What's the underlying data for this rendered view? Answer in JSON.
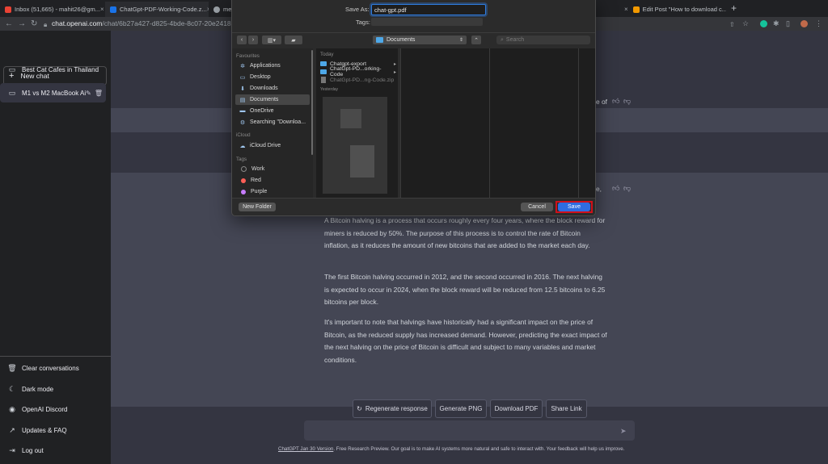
{
  "browser": {
    "tabs": [
      {
        "title": "Inbox (51,665) - mahit26@gm...",
        "color": "#ea4335"
      },
      {
        "title": "ChatGpt-PDF-Working-Code.z...",
        "color": "#1a73e8"
      },
      {
        "title": "me...",
        "color": "#9aa0a6"
      },
      {
        "title": "Edit Post \"How to download c...",
        "color": "#f29900"
      }
    ],
    "url_host": "chat.openai.com",
    "url_path": "/chat/6b27a427-d825-4bde-8c07-20e2418..."
  },
  "sidebar": {
    "new_chat": "New chat",
    "chats": [
      "Best Cat Cafes in Thailand",
      "M1 vs M2 MacBook Ai"
    ],
    "bottom": [
      "Clear conversations",
      "Dark mode",
      "OpenAI Discord",
      "Updates & FAQ",
      "Log out"
    ]
  },
  "dialog": {
    "save_as_label": "Save As:",
    "filename": "chat-gpt.pdf",
    "tags_label": "Tags:",
    "location": "Documents",
    "search_placeholder": "Search",
    "favourites_header": "Favourites",
    "favourites": [
      "Applications",
      "Desktop",
      "Downloads",
      "Documents",
      "OneDrive",
      "Searching \"Downloa..."
    ],
    "icloud_header": "iCloud",
    "icloud_items": [
      "iCloud Drive"
    ],
    "tags_header": "Tags",
    "tags": [
      {
        "name": "Work",
        "color": "#2b2b2b"
      },
      {
        "name": "Red",
        "color": "#ff5f57"
      },
      {
        "name": "Purple",
        "color": "#c77dff"
      }
    ],
    "today_header": "Today",
    "files": [
      "Chatgpt-export",
      "ChatGpt-PD...orking-Code",
      "ChatGpt-PD...ng-Code.zip"
    ],
    "yesterday_header": "Yesterday",
    "new_folder": "New Folder",
    "cancel": "Cancel",
    "save": "Save"
  },
  "chat": {
    "paragraphs": [
      "A Bitcoin halving is a process that occurs roughly every four years, where the block reward for miners is reduced by 50%. The purpose of this process is to control the rate of Bitcoin inflation, as it reduces the amount of new bitcoins that are added to the market each day.",
      "The first Bitcoin halving occurred in 2012, and the second occurred in 2016. The next halving is expected to occur in 2024, when the block reward will be reduced from 12.5 bitcoins to 6.25 bitcoins per block.",
      "It's important to note that halvings have historically had a significant impact on the price of Bitcoin, as the reduced supply has increased demand. However, predicting the exact impact of the next halving on the price of Bitcoin is difficult and subject to many variables and market conditions."
    ],
    "fragment_1": "e of",
    "fragment_2": "e,",
    "buttons": [
      "Regenerate response",
      "Generate PNG",
      "Download PDF",
      "Share Link"
    ],
    "footer_link": "ChatGPT Jan 30 Version",
    "footer_text": ". Free Research Preview. Our goal is to make AI systems more natural and safe to interact with. Your feedback will help us improve."
  }
}
